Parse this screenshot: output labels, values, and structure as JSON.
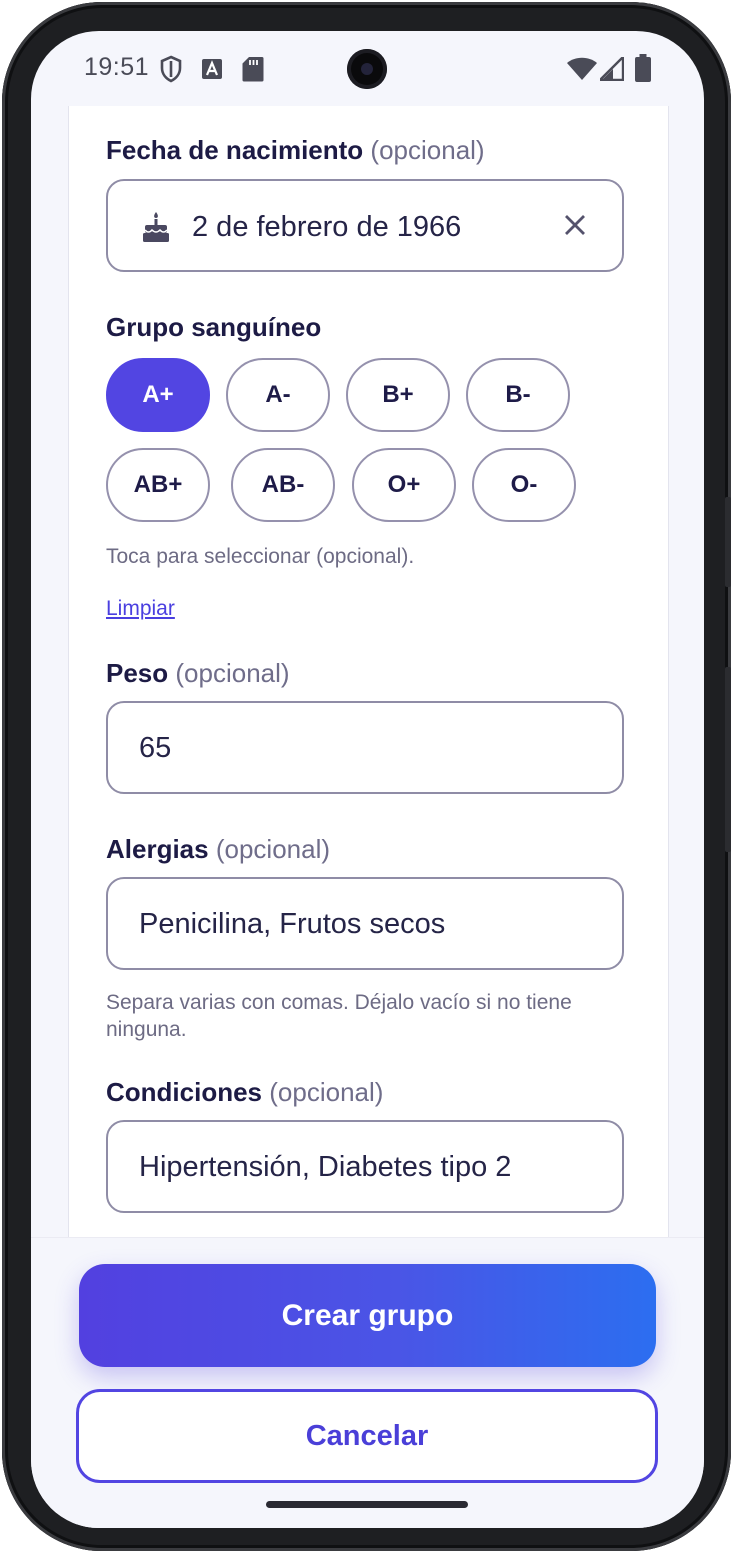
{
  "status_bar": {
    "time": "19:51",
    "icons": [
      "shield-icon",
      "font-a-icon",
      "sd-card-icon"
    ],
    "right_icons": [
      "wifi-icon",
      "signal-icon",
      "battery-icon"
    ]
  },
  "form": {
    "birth_date": {
      "label": "Fecha de nacimiento",
      "optional": "(opcional)",
      "value": "2 de febrero de 1966",
      "icon": "cake-icon",
      "clear_icon": "close-icon"
    },
    "blood_group": {
      "label": "Grupo sanguíneo",
      "options": [
        "A+",
        "A-",
        "B+",
        "B-",
        "AB+",
        "AB-",
        "O+",
        "O-"
      ],
      "selected": "A+",
      "helper": "Toca para seleccionar (opcional).",
      "clear_link": "Limpiar"
    },
    "weight": {
      "label": "Peso",
      "optional": "(opcional)",
      "value": "65"
    },
    "allergies": {
      "label": "Alergias",
      "optional": "(opcional)",
      "value": "Penicilina, Frutos secos",
      "helper": "Separa varias con comas. Déjalo vacío si no tiene ninguna."
    },
    "conditions": {
      "label": "Condiciones",
      "optional": "(opcional)",
      "value": "Hipertensión, Diabetes tipo 2"
    }
  },
  "actions": {
    "primary": "Crear grupo",
    "secondary": "Cancelar"
  },
  "colors": {
    "accent": "#5245e2",
    "gradient_end": "#2c6ef0",
    "text_dark": "#1d1b45",
    "muted": "#6f6d8a"
  }
}
